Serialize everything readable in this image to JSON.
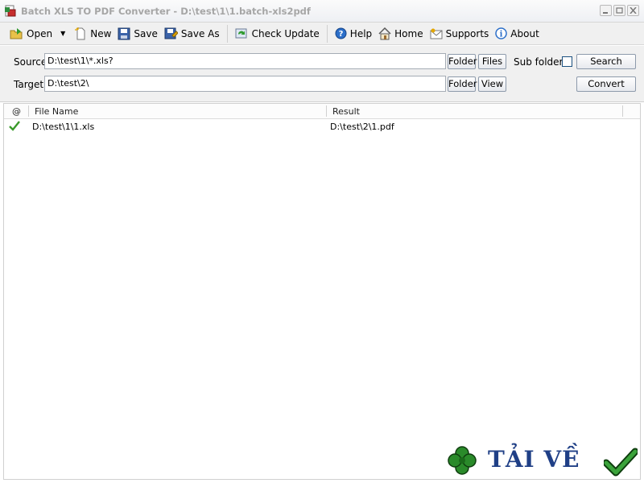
{
  "window": {
    "title": "Batch XLS TO PDF Converter - D:\\test\\1\\1.batch-xls2pdf"
  },
  "toolbar": {
    "open": "Open",
    "new": "New",
    "save": "Save",
    "save_as": "Save As",
    "check_update": "Check Update",
    "help": "Help",
    "home": "Home",
    "supports": "Supports",
    "about": "About"
  },
  "form": {
    "source_label": "Source",
    "source_value": "D:\\test\\1\\*.xls?",
    "target_label": "Target",
    "target_value": "D:\\test\\2\\",
    "folder_label": "Folder",
    "files_label": "Files",
    "view_label": "View",
    "subfolders_label": "Sub folders",
    "subfolders_checked": false,
    "search_label": "Search",
    "convert_label": "Convert"
  },
  "list": {
    "columns": [
      "@",
      "File Name",
      "Result"
    ],
    "rows": [
      {
        "status": "success",
        "file_name": "D:\\test\\1\\1.xls",
        "result": "D:\\test\\2\\1.pdf"
      }
    ]
  },
  "watermark": {
    "text": "TẢI VỀ"
  },
  "colors": {
    "accent_green": "#3a9a2a",
    "watermark_blue": "#1f3f86"
  }
}
